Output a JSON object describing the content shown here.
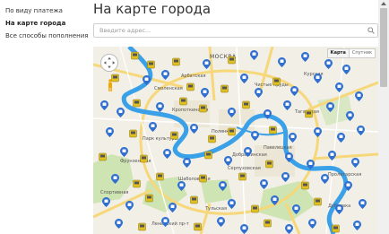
{
  "sidebar": {
    "items": [
      {
        "label": "По виду платежа",
        "active": false
      },
      {
        "label": "На карте города",
        "active": true
      },
      {
        "label": "Все способы пополнения",
        "active": false
      }
    ]
  },
  "page": {
    "title": "На карте города"
  },
  "search": {
    "placeholder": "Введите адрес..."
  },
  "map": {
    "type_buttons": [
      {
        "label": "Карта",
        "active": true
      },
      {
        "label": "Спутник",
        "active": false
      }
    ],
    "labels": [
      {
        "text": "МОСКВА",
        "style": "big"
      },
      {
        "text": "Смоленская"
      },
      {
        "text": "Арбатская"
      },
      {
        "text": "Кропоткинская"
      },
      {
        "text": "Полянка"
      },
      {
        "text": "Серпуховская"
      },
      {
        "text": "Павелецкая"
      },
      {
        "text": "Таганская"
      },
      {
        "text": "Курская"
      },
      {
        "text": "Чистые пруды"
      },
      {
        "text": "Парк культуры"
      },
      {
        "text": "Фрунзенская"
      },
      {
        "text": "Добрынинская"
      },
      {
        "text": "Шаболовская"
      },
      {
        "text": "Тульская"
      },
      {
        "text": "Пролетарская"
      },
      {
        "text": "Дубровка"
      },
      {
        "text": "Ленинский пр-т"
      },
      {
        "text": "Спортивная"
      }
    ]
  },
  "colors": {
    "bank_marker": "#2f6fcf",
    "terminal_marker": "#e0c020",
    "water": "#3aa0e8",
    "park": "#cfe4b3",
    "road_major": "#f6d77a"
  }
}
